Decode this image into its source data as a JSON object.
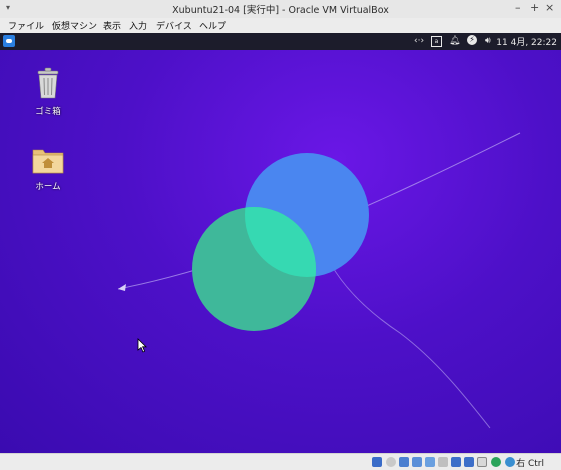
{
  "window": {
    "title": "Xubuntu21-04 [実行中] - Oracle VM VirtualBox",
    "menu": [
      "ファイル",
      "仮想マシン",
      "表示",
      "入力",
      "デバイス",
      "ヘルプ"
    ]
  },
  "guest_panel": {
    "clock": "11  4月, 22:22"
  },
  "desktop_icons": [
    {
      "label": "ゴミ箱",
      "icon": "trash-icon"
    },
    {
      "label": "ホーム",
      "icon": "home-folder-icon"
    }
  ],
  "statusbar": {
    "host_key": "右 Ctrl"
  },
  "colors": {
    "desktop_bg": "#5210d0",
    "circle_blue": "#4a86f0",
    "circle_green": "#3fb89a",
    "circle_overlap": "#36d9b2"
  }
}
